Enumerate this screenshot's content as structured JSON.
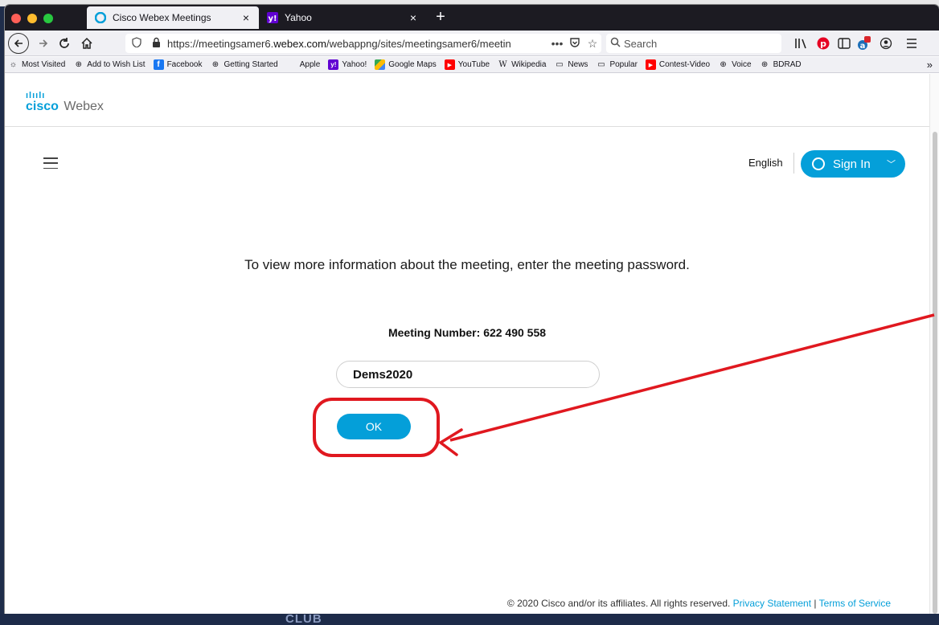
{
  "tabs": [
    {
      "title": "Cisco Webex Meetings",
      "active": true,
      "icon": "webex-icon"
    },
    {
      "title": "Yahoo",
      "active": false,
      "icon": "yahoo-icon"
    }
  ],
  "newtab_label": "+",
  "tab_close_glyph": "×",
  "nav": {
    "url_prefix": "https://meetingsamer6.",
    "url_domain": "webex.com",
    "url_rest": "/webappng/sites/meetingsamer6/meetin",
    "url_more": "•••",
    "search_placeholder": "Search"
  },
  "bookmarks": [
    {
      "label": "Most Visited",
      "icon": "gear-icon"
    },
    {
      "label": "Add to Wish List",
      "icon": "globe-icon"
    },
    {
      "label": "Facebook",
      "icon": "facebook-icon"
    },
    {
      "label": "Getting Started",
      "icon": "globe-icon"
    },
    {
      "label": "Apple",
      "icon": "apple-icon"
    },
    {
      "label": "Yahoo!",
      "icon": "yahoo-icon"
    },
    {
      "label": "Google Maps",
      "icon": "maps-icon"
    },
    {
      "label": "YouTube",
      "icon": "youtube-icon"
    },
    {
      "label": "Wikipedia",
      "icon": "wikipedia-icon"
    },
    {
      "label": "News",
      "icon": "folder-icon"
    },
    {
      "label": "Popular",
      "icon": "folder-icon"
    },
    {
      "label": "Contest-Video",
      "icon": "youtube-icon"
    },
    {
      "label": "Voice",
      "icon": "globe-icon"
    },
    {
      "label": "BDRAD",
      "icon": "globe-icon"
    }
  ],
  "bookmarks_more": "»",
  "header": {
    "logo_bars": "ılıılı",
    "logo_cisco": "cisco",
    "logo_webex": "Webex",
    "language": "English",
    "sign_in": "Sign In"
  },
  "main": {
    "prompt": "To view more information about the meeting, enter the meeting password.",
    "meeting_number_label": "Meeting Number:",
    "meeting_number": "622 490 558",
    "password_value": "Dems2020",
    "ok_label": "OK"
  },
  "footer": {
    "copyright": "© 2020 Cisco and/or its affiliates. All rights reserved.",
    "privacy": "Privacy Statement",
    "separator": "|",
    "terms": "Terms of Service"
  },
  "desktop_text": "CLUB",
  "colors": {
    "accent": "#049fd9",
    "annotation": "#e0181f"
  }
}
